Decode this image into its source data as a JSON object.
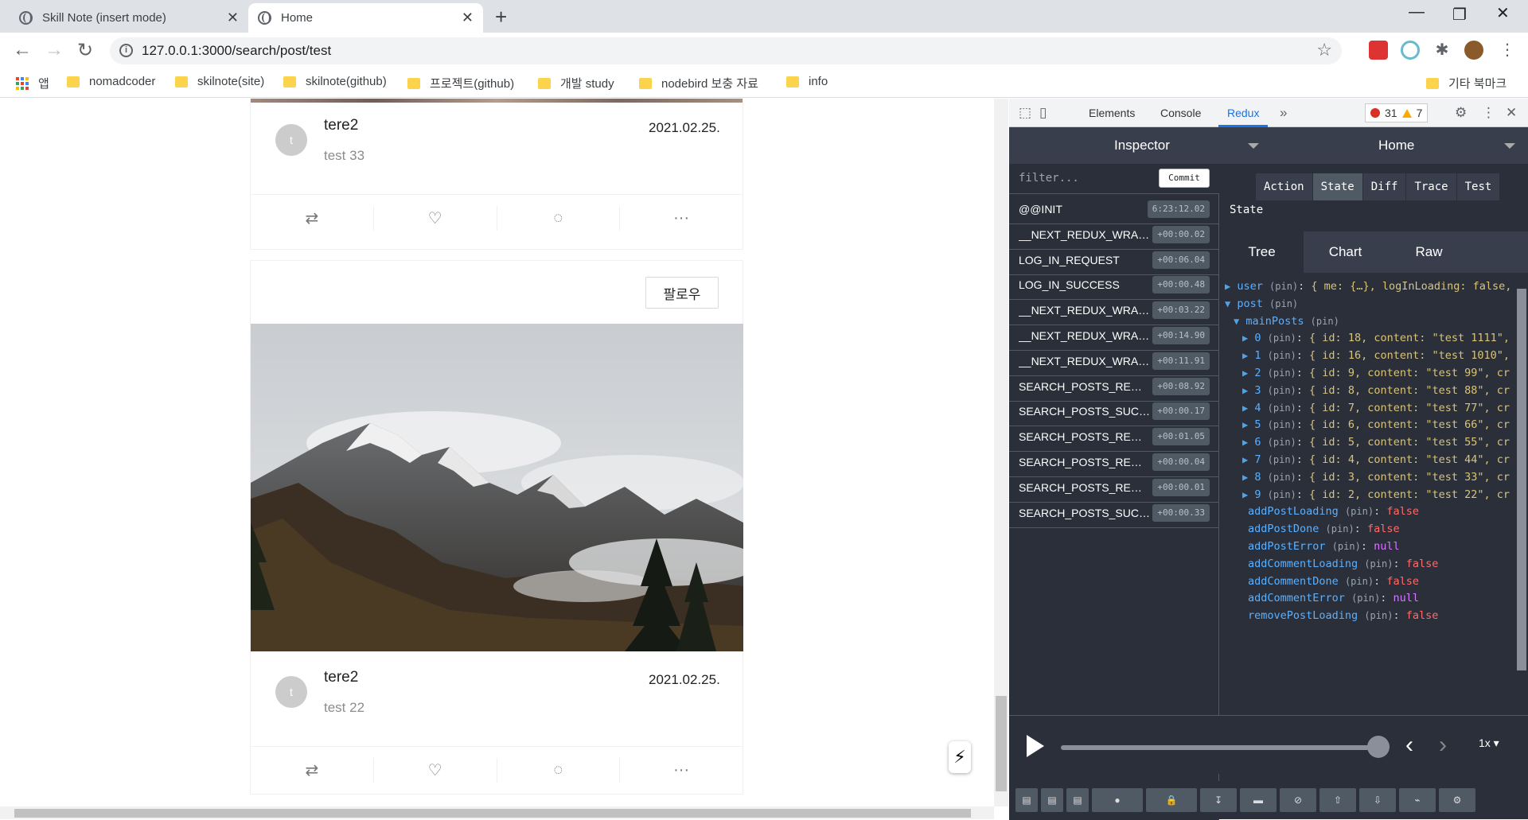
{
  "browser": {
    "tabs": [
      {
        "title": "Skill Note (insert mode)",
        "active": false
      },
      {
        "title": "Home",
        "active": true
      }
    ],
    "url": "127.0.0.1:3000/search/post/test",
    "bookmarks": [
      "앱",
      "nomadcoder",
      "skilnote(site)",
      "skilnote(github)",
      "프로젝트(github)",
      "개발 study",
      "nodebird 보충 자료",
      "info"
    ],
    "other_bookmarks": "기타 북마크"
  },
  "posts": [
    {
      "nickname": "tere2",
      "avatar_letter": "t",
      "content": "test 33",
      "date": "2021.02.25."
    },
    {
      "nickname": "tere2",
      "avatar_letter": "t",
      "content": "test 22",
      "date": "2021.02.25.",
      "follow_label": "팔로우"
    }
  ],
  "post_action_icons": [
    "retweet-icon",
    "heart-icon",
    "comment-icon",
    "ellipsis-icon"
  ],
  "devtools": {
    "tabs": [
      "Elements",
      "Console",
      "Redux"
    ],
    "active_tab": "Redux",
    "error_count": "31",
    "warning_count": "7",
    "inspector_label": "Inspector",
    "instance_label": "Home",
    "filter_placeholder": "filter...",
    "commit_label": "Commit",
    "actions": [
      {
        "name": "@@INIT",
        "time": "6:23:12.02"
      },
      {
        "name": "__NEXT_REDUX_WRAPPER_HYDRATE__",
        "time": "+00:00.02"
      },
      {
        "name": "LOG_IN_REQUEST",
        "time": "+00:06.04"
      },
      {
        "name": "LOG_IN_SUCCESS",
        "time": "+00:00.48"
      },
      {
        "name": "__NEXT_REDUX_WRAPPER_HYDRATE__",
        "time": "+00:03.22"
      },
      {
        "name": "__NEXT_REDUX_WRAPPER_HYDRATE__",
        "time": "+00:14.90"
      },
      {
        "name": "__NEXT_REDUX_WRAPPER_HYDRATE__",
        "time": "+00:11.91"
      },
      {
        "name": "SEARCH_POSTS_REQUEST",
        "time": "+00:08.92"
      },
      {
        "name": "SEARCH_POSTS_SUCCESS",
        "time": "+00:00.17"
      },
      {
        "name": "SEARCH_POSTS_REQUEST",
        "time": "+00:01.05"
      },
      {
        "name": "SEARCH_POSTS_REQUEST",
        "time": "+00:00.04"
      },
      {
        "name": "SEARCH_POSTS_REQUEST",
        "time": "+00:00.01"
      },
      {
        "name": "SEARCH_POSTS_SUCCESS",
        "time": "+00:00.33"
      }
    ],
    "monitor_tabs": [
      "Action",
      "State",
      "Diff",
      "Trace",
      "Test"
    ],
    "active_monitor_tab": "State",
    "state_label": "State",
    "view_tabs": [
      "Tree",
      "Chart",
      "Raw"
    ],
    "active_view_tab": "Tree",
    "tree": [
      {
        "indent": 0,
        "arrow": "▶",
        "key": "user",
        "value": "{ me: {…}, logInLoading: false,",
        "vclass": "val"
      },
      {
        "indent": 0,
        "arrow": "▼",
        "key": "post",
        "value": "",
        "vclass": "val"
      },
      {
        "indent": 1,
        "arrow": "▼",
        "key": "mainPosts",
        "value": "",
        "vclass": "val"
      },
      {
        "indent": 2,
        "arrow": "▶",
        "key": "0",
        "value": "{ id: 18, content: \"test 1111\",",
        "vclass": "val"
      },
      {
        "indent": 2,
        "arrow": "▶",
        "key": "1",
        "value": "{ id: 16, content: \"test 1010\",",
        "vclass": "val"
      },
      {
        "indent": 2,
        "arrow": "▶",
        "key": "2",
        "value": "{ id: 9, content: \"test 99\", cr",
        "vclass": "val"
      },
      {
        "indent": 2,
        "arrow": "▶",
        "key": "3",
        "value": "{ id: 8, content: \"test 88\", cr",
        "vclass": "val"
      },
      {
        "indent": 2,
        "arrow": "▶",
        "key": "4",
        "value": "{ id: 7, content: \"test 77\", cr",
        "vclass": "val"
      },
      {
        "indent": 2,
        "arrow": "▶",
        "key": "5",
        "value": "{ id: 6, content: \"test 66\", cr",
        "vclass": "val"
      },
      {
        "indent": 2,
        "arrow": "▶",
        "key": "6",
        "value": "{ id: 5, content: \"test 55\", cr",
        "vclass": "val"
      },
      {
        "indent": 2,
        "arrow": "▶",
        "key": "7",
        "value": "{ id: 4, content: \"test 44\", cr",
        "vclass": "val"
      },
      {
        "indent": 2,
        "arrow": "▶",
        "key": "8",
        "value": "{ id: 3, content: \"test 33\", cr",
        "vclass": "val"
      },
      {
        "indent": 2,
        "arrow": "▶",
        "key": "9",
        "value": "{ id: 2, content: \"test 22\", cr",
        "vclass": "val"
      },
      {
        "indent": 1,
        "arrow": "",
        "key": "addPostLoading",
        "value": "false",
        "vclass": "valf"
      },
      {
        "indent": 1,
        "arrow": "",
        "key": "addPostDone",
        "value": "false",
        "vclass": "valf"
      },
      {
        "indent": 1,
        "arrow": "",
        "key": "addPostError",
        "value": "null",
        "vclass": "valn"
      },
      {
        "indent": 1,
        "arrow": "",
        "key": "addCommentLoading",
        "value": "false",
        "vclass": "valf"
      },
      {
        "indent": 1,
        "arrow": "",
        "key": "addCommentDone",
        "value": "false",
        "vclass": "valf"
      },
      {
        "indent": 1,
        "arrow": "",
        "key": "addCommentError",
        "value": "null",
        "vclass": "valn"
      },
      {
        "indent": 1,
        "arrow": "",
        "key": "removePostLoading",
        "value": "false",
        "vclass": "valf"
      }
    ],
    "pin_label": "(pin)",
    "speed_label": "1x"
  }
}
